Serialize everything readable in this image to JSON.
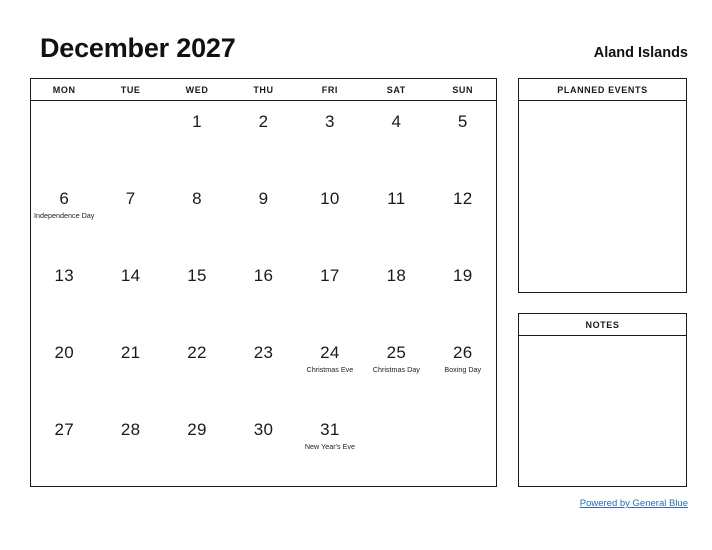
{
  "header": {
    "title": "December 2027",
    "region": "Aland Islands"
  },
  "calendar": {
    "weekday_headers": [
      "MON",
      "TUE",
      "WED",
      "THU",
      "FRI",
      "SAT",
      "SUN"
    ],
    "weeks": [
      [
        {
          "day": "",
          "event": ""
        },
        {
          "day": "",
          "event": ""
        },
        {
          "day": "1",
          "event": ""
        },
        {
          "day": "2",
          "event": ""
        },
        {
          "day": "3",
          "event": ""
        },
        {
          "day": "4",
          "event": ""
        },
        {
          "day": "5",
          "event": ""
        }
      ],
      [
        {
          "day": "6",
          "event": "Independence Day"
        },
        {
          "day": "7",
          "event": ""
        },
        {
          "day": "8",
          "event": ""
        },
        {
          "day": "9",
          "event": ""
        },
        {
          "day": "10",
          "event": ""
        },
        {
          "day": "11",
          "event": ""
        },
        {
          "day": "12",
          "event": ""
        }
      ],
      [
        {
          "day": "13",
          "event": ""
        },
        {
          "day": "14",
          "event": ""
        },
        {
          "day": "15",
          "event": ""
        },
        {
          "day": "16",
          "event": ""
        },
        {
          "day": "17",
          "event": ""
        },
        {
          "day": "18",
          "event": ""
        },
        {
          "day": "19",
          "event": ""
        }
      ],
      [
        {
          "day": "20",
          "event": ""
        },
        {
          "day": "21",
          "event": ""
        },
        {
          "day": "22",
          "event": ""
        },
        {
          "day": "23",
          "event": ""
        },
        {
          "day": "24",
          "event": "Christmas Eve"
        },
        {
          "day": "25",
          "event": "Christmas Day"
        },
        {
          "day": "26",
          "event": "Boxing Day"
        }
      ],
      [
        {
          "day": "27",
          "event": ""
        },
        {
          "day": "28",
          "event": ""
        },
        {
          "day": "29",
          "event": ""
        },
        {
          "day": "30",
          "event": ""
        },
        {
          "day": "31",
          "event": "New Year's Eve"
        },
        {
          "day": "",
          "event": ""
        },
        {
          "day": "",
          "event": ""
        }
      ]
    ]
  },
  "panels": {
    "planned_events": {
      "title": "PLANNED EVENTS",
      "content": ""
    },
    "notes": {
      "title": "NOTES",
      "content": ""
    }
  },
  "footer": {
    "link_text": "Powered by General Blue",
    "link_color": "#2b6cb8"
  }
}
